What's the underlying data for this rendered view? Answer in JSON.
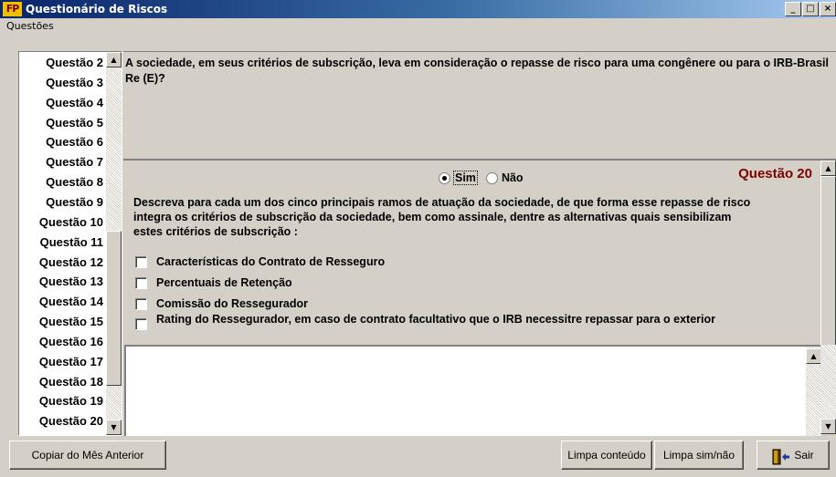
{
  "window": {
    "title": "Questionário de Riscos",
    "icon_text": "FP",
    "controls": [
      "minimize-icon",
      "maximize-icon",
      "close-icon"
    ]
  },
  "menu": {
    "label": "Questões"
  },
  "question_list": {
    "items": [
      "Questão 2",
      "Questão 3",
      "Questão 4",
      "Questão 5",
      "Questão 6",
      "Questão 7",
      "Questão 8",
      "Questão 9",
      "Questão 10",
      "Questão 11",
      "Questão 12",
      "Questão 13",
      "Questão 14",
      "Questão 15",
      "Questão 16",
      "Questão 17",
      "Questão 18",
      "Questão 19",
      "Questão 20"
    ]
  },
  "question": {
    "text": "A sociedade, em seus critérios de subscrição, leva em consideração o repasse de risco para uma congênere ou para o IRB-Brasil Re (E)?",
    "number_label": "Questão 20"
  },
  "answer": {
    "options": [
      "Sim",
      "Não"
    ],
    "selected": "Sim",
    "description": "Descreva para cada um dos cinco principais ramos de atuação da sociedade, de que forma esse repasse de risco integra os critérios de subscrição da sociedade, bem como assinale, dentre as alternativas quais sensibilizam estes critérios de subscrição :",
    "checkboxes": [
      {
        "label": "Características do Contrato de Resseguro",
        "checked": false
      },
      {
        "label": "Percentuais de Retenção",
        "checked": false
      },
      {
        "label": "Comissão do Ressegurador",
        "checked": false
      },
      {
        "label": "Rating do Ressegurador, em caso de contrato facultativo que o IRB necessitre repassar para o exterior",
        "checked": false
      }
    ],
    "text_value": ""
  },
  "buttons": {
    "copy_previous": "Copiar do Mês Anterior",
    "clear_content": "Limpa conteúdo",
    "clear_yes_no": "Limpa sim/não",
    "exit": "Sair"
  }
}
